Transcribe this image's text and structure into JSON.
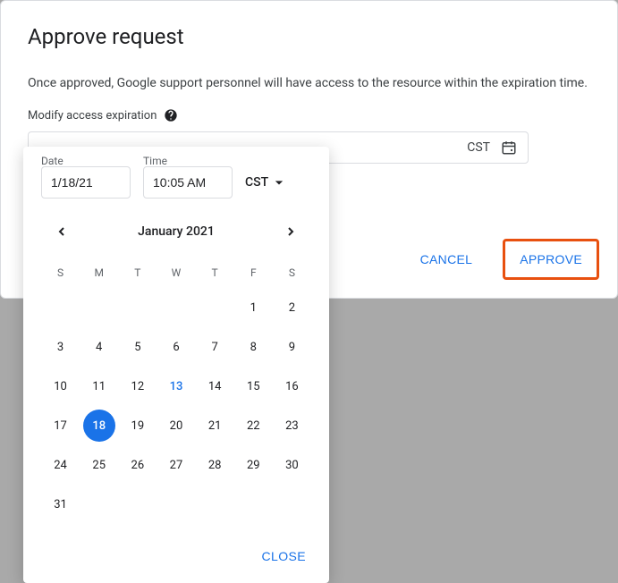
{
  "dialog": {
    "title": "Approve request",
    "description": "Once approved, Google support personnel will have access to the resource within the expiration time.",
    "modify_label": "Modify access expiration",
    "datetime_field": {
      "tz": "CST"
    },
    "actions": {
      "cancel": "CANCEL",
      "approve": "APPROVE"
    }
  },
  "datepicker": {
    "date_label": "Date",
    "date_value": "1/18/21",
    "time_label": "Time",
    "time_value": "10:05 AM",
    "tz": "CST",
    "month_label": "January 2021",
    "dow": [
      "S",
      "M",
      "T",
      "W",
      "T",
      "F",
      "S"
    ],
    "leading_blanks": 5,
    "days": 31,
    "today": 13,
    "selected": 18,
    "close": "CLOSE"
  }
}
